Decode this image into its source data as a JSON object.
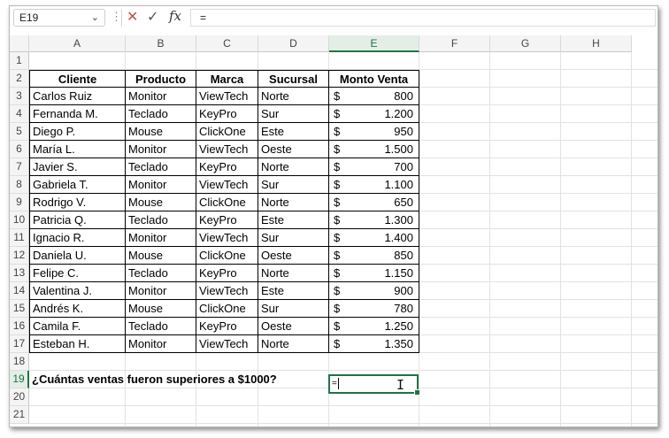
{
  "name_box": "E19",
  "formula_bar": {
    "value": "=",
    "cancel_icon": "x-icon",
    "enter_icon": "check-icon",
    "function_label": "fx"
  },
  "columns": [
    "A",
    "B",
    "C",
    "D",
    "E",
    "F",
    "G",
    "H"
  ],
  "rows": [
    "1",
    "2",
    "3",
    "4",
    "5",
    "6",
    "7",
    "8",
    "9",
    "10",
    "11",
    "12",
    "13",
    "14",
    "15",
    "16",
    "17",
    "18",
    "19",
    "20",
    "21"
  ],
  "table": {
    "headers": [
      "Cliente",
      "Producto",
      "Marca",
      "Sucursal",
      "Monto Venta"
    ],
    "currency": "$",
    "rows": [
      [
        "Carlos Ruiz",
        "Monitor",
        "ViewTech",
        "Norte",
        "800"
      ],
      [
        "Fernanda M.",
        "Teclado",
        "KeyPro",
        "Sur",
        "1.200"
      ],
      [
        "Diego P.",
        "Mouse",
        "ClickOne",
        "Este",
        "950"
      ],
      [
        "María L.",
        "Monitor",
        "ViewTech",
        "Oeste",
        "1.500"
      ],
      [
        "Javier S.",
        "Teclado",
        "KeyPro",
        "Norte",
        "700"
      ],
      [
        "Gabriela T.",
        "Monitor",
        "ViewTech",
        "Sur",
        "1.100"
      ],
      [
        "Rodrigo V.",
        "Mouse",
        "ClickOne",
        "Norte",
        "650"
      ],
      [
        "Patricia Q.",
        "Teclado",
        "KeyPro",
        "Este",
        "1.300"
      ],
      [
        "Ignacio R.",
        "Monitor",
        "ViewTech",
        "Sur",
        "1.400"
      ],
      [
        "Daniela U.",
        "Mouse",
        "ClickOne",
        "Oeste",
        "850"
      ],
      [
        "Felipe C.",
        "Teclado",
        "KeyPro",
        "Norte",
        "1.150"
      ],
      [
        "Valentina J.",
        "Monitor",
        "ViewTech",
        "Este",
        "900"
      ],
      [
        "Andrés K.",
        "Mouse",
        "ClickOne",
        "Sur",
        "780"
      ],
      [
        "Camila F.",
        "Teclado",
        "KeyPro",
        "Oeste",
        "1.250"
      ],
      [
        "Esteban H.",
        "Monitor",
        "ViewTech",
        "Norte",
        "1.350"
      ]
    ]
  },
  "question": "¿Cuántas ventas fueron superiores a $1000?",
  "active_cell": {
    "ref": "E19",
    "value": "="
  },
  "colors": {
    "accent": "#217346",
    "header_active_bg": "#e3efe6",
    "grid_line": "#e2e2e2"
  }
}
